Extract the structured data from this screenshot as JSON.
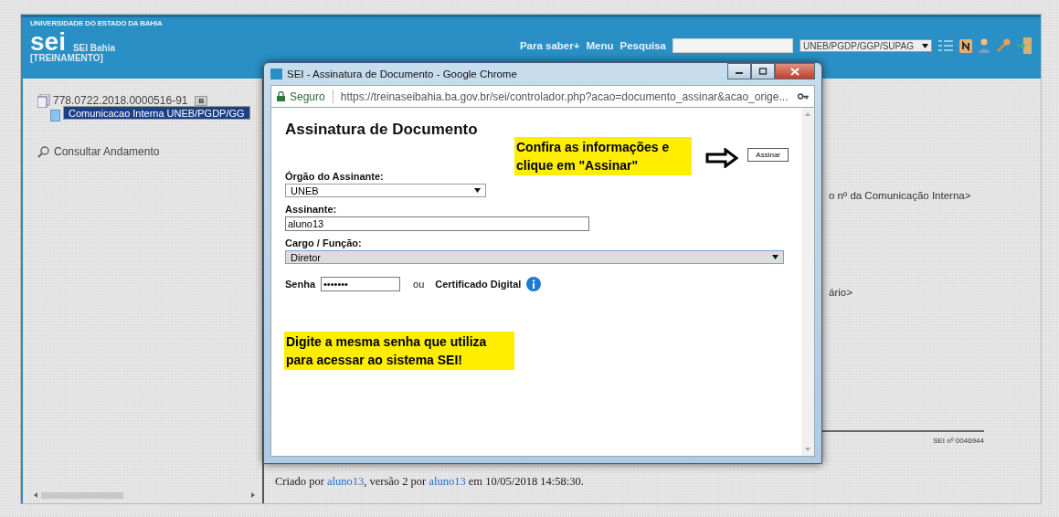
{
  "header": {
    "institution": "UNIVERSIDADE DO ESTADO DA BAHIA",
    "logo": "sei",
    "system_name": "SEI Bahia",
    "environment": "[TREINAMENTO]",
    "nav": [
      "Para saber+",
      "Menu",
      "Pesquisa"
    ],
    "unit": "UNEB/PGDP/GGP/SUPAG"
  },
  "tree": {
    "process": "778.0722.2018.0000516-91",
    "badge": "B",
    "document": {
      "label": "Comunicacao Interna UNEB/PGDP/GG",
      "selected": true
    },
    "action": "Consultar Andamento"
  },
  "document": {
    "fragments": [
      "o nº da Comunicação Interna>",
      "ário>"
    ],
    "sei_number": "SEI nº 0046944",
    "footer": [
      {
        "kind": "text",
        "text": "Criado por "
      },
      {
        "kind": "link",
        "text": "aluno13"
      },
      {
        "kind": "text",
        "text": ", versão 2 por "
      },
      {
        "kind": "link",
        "text": "aluno13"
      },
      {
        "kind": "text",
        "text": " em 10/05/2018 14:58:30."
      }
    ]
  },
  "dialog": {
    "window_title": "SEI - Assinatura de Documento - Google Chrome",
    "secure_label": "Seguro",
    "url": "https://treinaseibahia.ba.gov.br/sei/controlador.php?acao=documento_assinar&acao_orige...",
    "heading": "Assinatura de Documento",
    "sign_button": "Assinar",
    "orgao": {
      "label": "Órgão do Assinante:",
      "value": "UNEB"
    },
    "assinante": {
      "label": "Assinante:",
      "value": "aluno13"
    },
    "cargo": {
      "label": "Cargo / Função:",
      "value": "Diretor"
    },
    "senha": {
      "label": "Senha",
      "value": "•••••••"
    },
    "or_text": "ou",
    "certificate": "Certificado Digital",
    "callouts": [
      "Confira as informações e clique em \"Assinar\"",
      "Digite a mesma senha que utiliza para acessar ao sistema SEI!"
    ]
  }
}
